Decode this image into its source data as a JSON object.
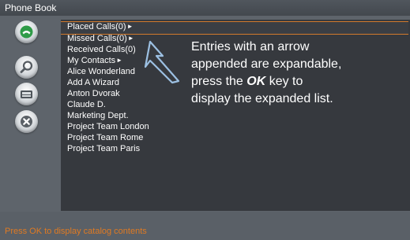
{
  "window": {
    "title": "Phone Book"
  },
  "icons": [
    {
      "name": "phone-call-icon",
      "accent": "#2e9b47"
    },
    {
      "name": "search-icon"
    },
    {
      "name": "contacts-icon"
    },
    {
      "name": "delete-icon"
    }
  ],
  "list": {
    "selected_index": 0,
    "items": [
      {
        "label": "Placed Calls(0)",
        "arrow": "►"
      },
      {
        "label": "Missed Calls(0)",
        "arrow": "►"
      },
      {
        "label": "Received Calls(0)",
        "arrow": ""
      },
      {
        "label": "My Contacts",
        "arrow": "►"
      },
      {
        "label": "Alice Wonderland",
        "arrow": ""
      },
      {
        "label": "Add A Wizard",
        "arrow": ""
      },
      {
        "label": "Anton Dvorak",
        "arrow": ""
      },
      {
        "label": "Claude D.",
        "arrow": ""
      },
      {
        "label": "Marketing Dept.",
        "arrow": ""
      },
      {
        "label": "Project Team London",
        "arrow": ""
      },
      {
        "label": "Project Team Rome",
        "arrow": ""
      },
      {
        "label": "Project Team Paris",
        "arrow": ""
      }
    ]
  },
  "callout": {
    "line1": "Entries with an arrow",
    "line2": "appended are expandable,",
    "line3_pre": "press the ",
    "line3_key": "OK",
    "line3_post": " key to",
    "line4": "display the expanded list."
  },
  "status": {
    "text": "Press OK to display catalog contents"
  },
  "colors": {
    "accent": "#d27a2c",
    "status_text": "#e07a22",
    "panel": "#36393e",
    "background": "#5e646b"
  }
}
